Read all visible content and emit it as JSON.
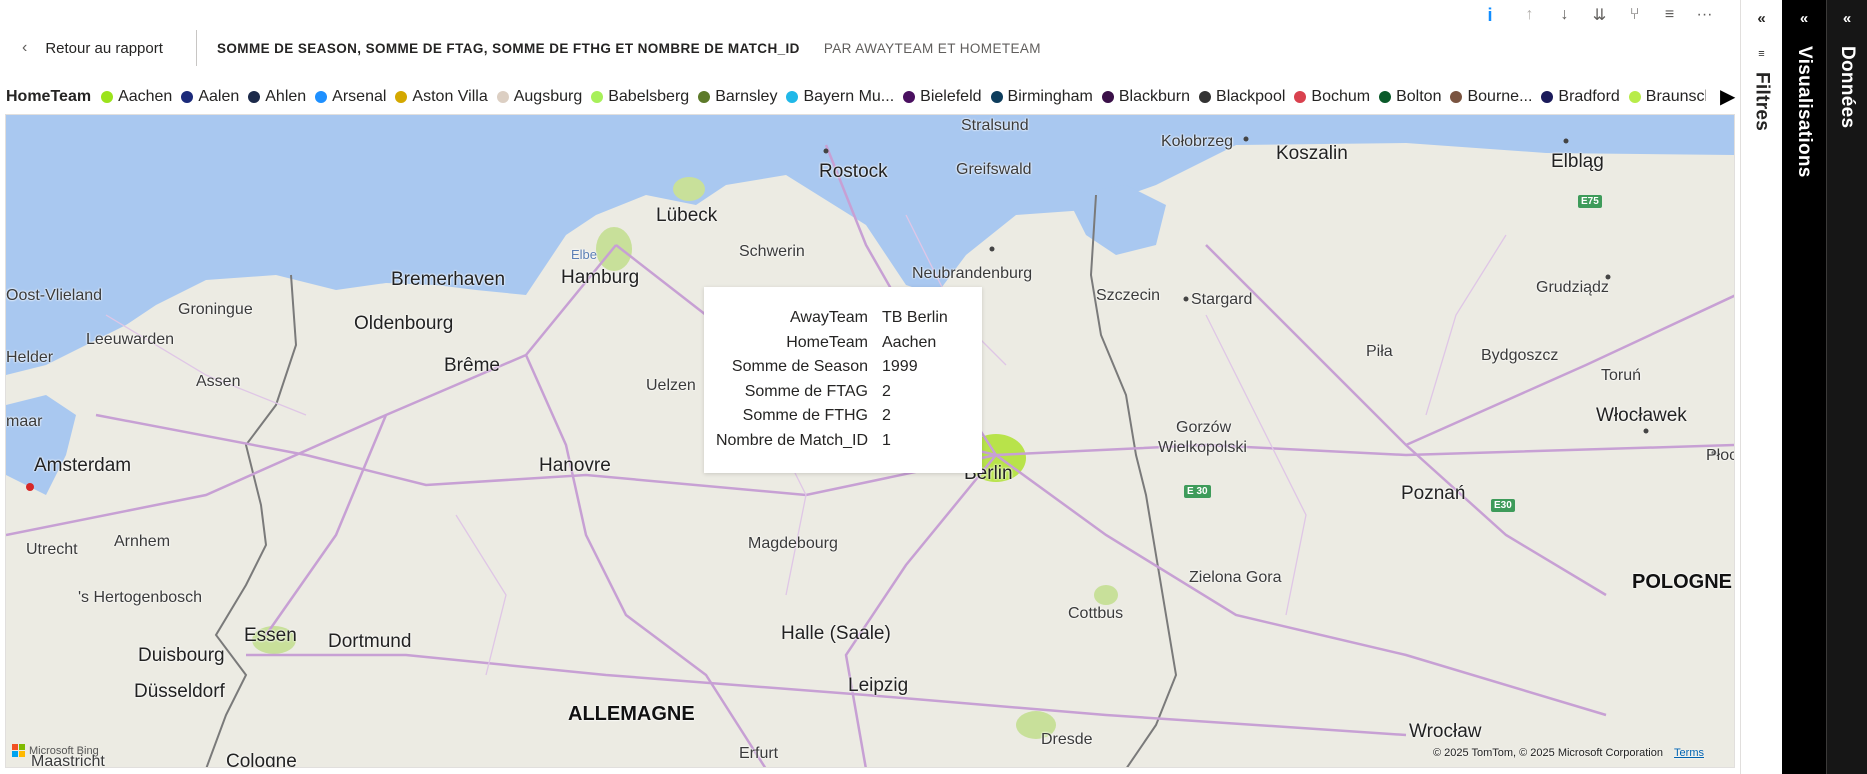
{
  "toolbar": {
    "buttons": [
      "info-icon",
      "drill-up-icon",
      "drill-down-icon",
      "expand-all-icon",
      "hierarchy-icon",
      "filter-icon",
      "more-options-icon"
    ]
  },
  "header": {
    "back_label": "Retour au rapport",
    "visual_title": "SOMME DE SEASON, SOMME DE FTAG, SOMME DE FTHG ET NOMBRE DE MATCH_ID",
    "visual_subtitle": "PAR AWAYTEAM ET HOMETEAM"
  },
  "legend": {
    "title": "HomeTeam",
    "items": [
      {
        "label": "Aachen",
        "color": "#9be31c"
      },
      {
        "label": "Aalen",
        "color": "#1b2a7a"
      },
      {
        "label": "Ahlen",
        "color": "#1c2a4a"
      },
      {
        "label": "Arsenal",
        "color": "#1e90ff"
      },
      {
        "label": "Aston Villa",
        "color": "#d4a800"
      },
      {
        "label": "Augsburg",
        "color": "#dccfc3"
      },
      {
        "label": "Babelsberg",
        "color": "#a7f05a"
      },
      {
        "label": "Barnsley",
        "color": "#5d7a2a"
      },
      {
        "label": "Bayern Mu...",
        "color": "#20b8e8"
      },
      {
        "label": "Bielefeld",
        "color": "#4a1060"
      },
      {
        "label": "Birmingham",
        "color": "#0d3c5c"
      },
      {
        "label": "Blackburn",
        "color": "#3a1048"
      },
      {
        "label": "Blackpool",
        "color": "#333333"
      },
      {
        "label": "Bochum",
        "color": "#d9414e"
      },
      {
        "label": "Bolton",
        "color": "#0a5a2a"
      },
      {
        "label": "Bourne...",
        "color": "#7a5440"
      },
      {
        "label": "Bradford",
        "color": "#1a1a5a"
      },
      {
        "label": "Braunsch...",
        "color": "#b8ec4a"
      }
    ]
  },
  "tooltip": {
    "rows": [
      {
        "key": "AwayTeam",
        "value": "TB Berlin"
      },
      {
        "key": "HomeTeam",
        "value": "Aachen"
      },
      {
        "key": "Somme de Season",
        "value": "1999"
      },
      {
        "key": "Somme de FTAG",
        "value": "2"
      },
      {
        "key": "Somme de FTHG",
        "value": "2"
      },
      {
        "key": "Nombre de Match_ID",
        "value": "1"
      }
    ]
  },
  "map": {
    "cities": {
      "stralsund": "Stralsund",
      "kolobrzeg": "Kołobrzeg",
      "koszalin": "Koszalin",
      "elblag": "Elbląg",
      "rostock": "Rostock",
      "greifswald": "Greifswald",
      "lubeck": "Lübeck",
      "schwerin": "Schwerin",
      "elbe": "Elbe",
      "ostvlieland": "Oost-Vlieland",
      "bremerhaven": "Bremerhaven",
      "hamburg": "Hamburg",
      "neubrandenburg": "Neubrandenburg",
      "szczecin": "Szczecin",
      "stargard": "Stargard",
      "grudziadz": "Grudziądz",
      "groningue": "Groningue",
      "leeuwarden": "Leeuwarden",
      "oldenbourg": "Oldenbourg",
      "helder": "Helder",
      "assen": "Assen",
      "breme": "Brême",
      "uelzen": "Uelzen",
      "pila": "Piła",
      "bydgoszcz": "Bydgoszcz",
      "torun": "Toruń",
      "imaar": "maar",
      "wloclawek": "Włocławek",
      "amsterdam": "Amsterdam",
      "hanovre": "Hanovre",
      "berlin": "Berlin",
      "gorzow": "Gorzów",
      "wielkopolski": "Wielkopolski",
      "plock": "Płock",
      "poznan": "Poznań",
      "utrecht": "Utrecht",
      "arnhem": "Arnhem",
      "magdebourg": "Magdebourg",
      "hertogenbosch": "'s Hertogenbosch",
      "zielona": "Zielona Gora",
      "pologne": "POLOGNE",
      "cottbus": "Cottbus",
      "essen": "Essen",
      "dortmund": "Dortmund",
      "halle": "Halle (Saale)",
      "duisbourg": "Duisbourg",
      "leipzig": "Leipzig",
      "dusseldorf": "Düsseldorf",
      "allemagne": "ALLEMAGNE",
      "dresde": "Dresde",
      "wroclaw": "Wrocław",
      "erfurt": "Erfurt",
      "maastricht": "Maastricht",
      "cologne": "Cologne"
    },
    "shields": {
      "e75": "E75",
      "e30a": "E 30",
      "e30b": "E30"
    },
    "attribution": "© 2025 TomTom, © 2025 Microsoft Corporation",
    "terms": "Terms",
    "bing": "Microsoft Bing"
  },
  "panes": {
    "filters": "Filtres",
    "visualizations": "Visualisations",
    "data": "Données",
    "collapse_glyph": "«"
  },
  "colors": {
    "water": "#a9c8f0",
    "land": "#ecebe3",
    "roads": "#c7a0d4",
    "accent": "#118dff"
  }
}
